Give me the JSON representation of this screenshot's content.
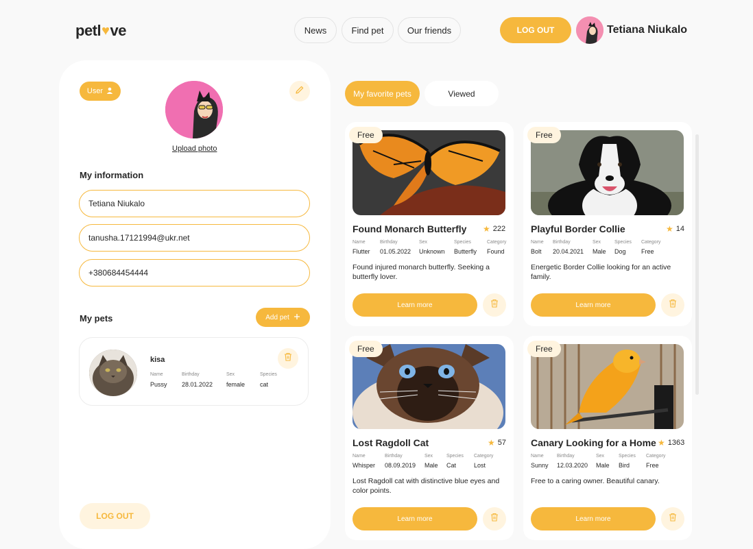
{
  "header": {
    "logo_left": "petl",
    "logo_right": "ve",
    "nav": [
      "News",
      "Find pet",
      "Our friends"
    ],
    "logout": "LOG OUT",
    "user_name": "Tetiana Niukalo"
  },
  "profile": {
    "badge": "User",
    "upload": "Upload photo",
    "info_title": "My information",
    "name": "Tetiana Niukalo",
    "email": "tanusha.17121994@ukr.net",
    "phone": "+380684454444",
    "pets_title": "My pets",
    "add_pet": "Add pet",
    "logout": "LOG OUT"
  },
  "my_pet": {
    "name": "kisa",
    "labels": [
      "Name",
      "Birthday",
      "Sex",
      "Species"
    ],
    "values": [
      "Pussy",
      "28.01.2022",
      "female",
      "cat"
    ]
  },
  "tabs": {
    "favorites": "My favorite pets",
    "viewed": "Viewed"
  },
  "cards": [
    {
      "badge": "Free",
      "title": "Found Monarch Butterfly",
      "rating": "222",
      "labels": [
        "Name",
        "Birthday",
        "Sex",
        "Species",
        "Category"
      ],
      "values": [
        "Flutter",
        "01.05.2022",
        "Unknown",
        "Butterfly",
        "Found"
      ],
      "desc": "Found injured monarch butterfly. Seeking a butterfly lover.",
      "button": "Learn more"
    },
    {
      "badge": "Free",
      "title": "Playful Border Collie",
      "rating": "14",
      "labels": [
        "Name",
        "Birthday",
        "Sex",
        "Species",
        "Category"
      ],
      "values": [
        "Bolt",
        "20.04.2021",
        "Male",
        "Dog",
        "Free"
      ],
      "desc": "Energetic Border Collie looking for an active family.",
      "button": "Learn more"
    },
    {
      "badge": "Free",
      "title": "Lost Ragdoll Cat",
      "rating": "57",
      "labels": [
        "Name",
        "Birthday",
        "Sex",
        "Species",
        "Category"
      ],
      "values": [
        "Whisper",
        "08.09.2019",
        "Male",
        "Cat",
        "Lost"
      ],
      "desc": "Lost Ragdoll cat with distinctive blue eyes and color points.",
      "button": "Learn more"
    },
    {
      "badge": "Free",
      "title": "Canary Looking for a Home",
      "rating": "1363",
      "labels": [
        "Name",
        "Birthday",
        "Sex",
        "Species",
        "Category"
      ],
      "values": [
        "Sunny",
        "12.03.2020",
        "Male",
        "Bird",
        "Free"
      ],
      "desc": "Free to a caring owner. Beautiful canary.",
      "button": "Learn more"
    }
  ],
  "colors": {
    "accent": "#f6b83d",
    "accent_light": "#fff4df",
    "text": "#262626",
    "background": "#f9f9f9"
  }
}
